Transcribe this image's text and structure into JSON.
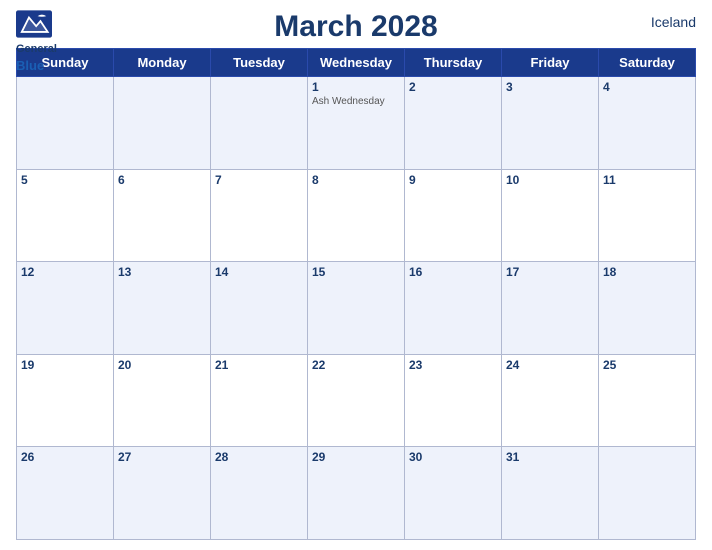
{
  "header": {
    "title": "March 2028",
    "country": "Iceland",
    "logo": {
      "line1": "General",
      "line2": "Blue"
    }
  },
  "weekdays": [
    "Sunday",
    "Monday",
    "Tuesday",
    "Wednesday",
    "Thursday",
    "Friday",
    "Saturday"
  ],
  "weeks": [
    [
      {
        "day": "",
        "holiday": ""
      },
      {
        "day": "",
        "holiday": ""
      },
      {
        "day": "",
        "holiday": ""
      },
      {
        "day": "1",
        "holiday": "Ash Wednesday"
      },
      {
        "day": "2",
        "holiday": ""
      },
      {
        "day": "3",
        "holiday": ""
      },
      {
        "day": "4",
        "holiday": ""
      }
    ],
    [
      {
        "day": "5",
        "holiday": ""
      },
      {
        "day": "6",
        "holiday": ""
      },
      {
        "day": "7",
        "holiday": ""
      },
      {
        "day": "8",
        "holiday": ""
      },
      {
        "day": "9",
        "holiday": ""
      },
      {
        "day": "10",
        "holiday": ""
      },
      {
        "day": "11",
        "holiday": ""
      }
    ],
    [
      {
        "day": "12",
        "holiday": ""
      },
      {
        "day": "13",
        "holiday": ""
      },
      {
        "day": "14",
        "holiday": ""
      },
      {
        "day": "15",
        "holiday": ""
      },
      {
        "day": "16",
        "holiday": ""
      },
      {
        "day": "17",
        "holiday": ""
      },
      {
        "day": "18",
        "holiday": ""
      }
    ],
    [
      {
        "day": "19",
        "holiday": ""
      },
      {
        "day": "20",
        "holiday": ""
      },
      {
        "day": "21",
        "holiday": ""
      },
      {
        "day": "22",
        "holiday": ""
      },
      {
        "day": "23",
        "holiday": ""
      },
      {
        "day": "24",
        "holiday": ""
      },
      {
        "day": "25",
        "holiday": ""
      }
    ],
    [
      {
        "day": "26",
        "holiday": ""
      },
      {
        "day": "27",
        "holiday": ""
      },
      {
        "day": "28",
        "holiday": ""
      },
      {
        "day": "29",
        "holiday": ""
      },
      {
        "day": "30",
        "holiday": ""
      },
      {
        "day": "31",
        "holiday": ""
      },
      {
        "day": "",
        "holiday": ""
      }
    ]
  ],
  "colors": {
    "header_bg": "#1a3a8c",
    "header_text": "#ffffff",
    "title_color": "#1a3a6b",
    "row_odd": "#dce6f7",
    "row_even": "#ffffff"
  }
}
